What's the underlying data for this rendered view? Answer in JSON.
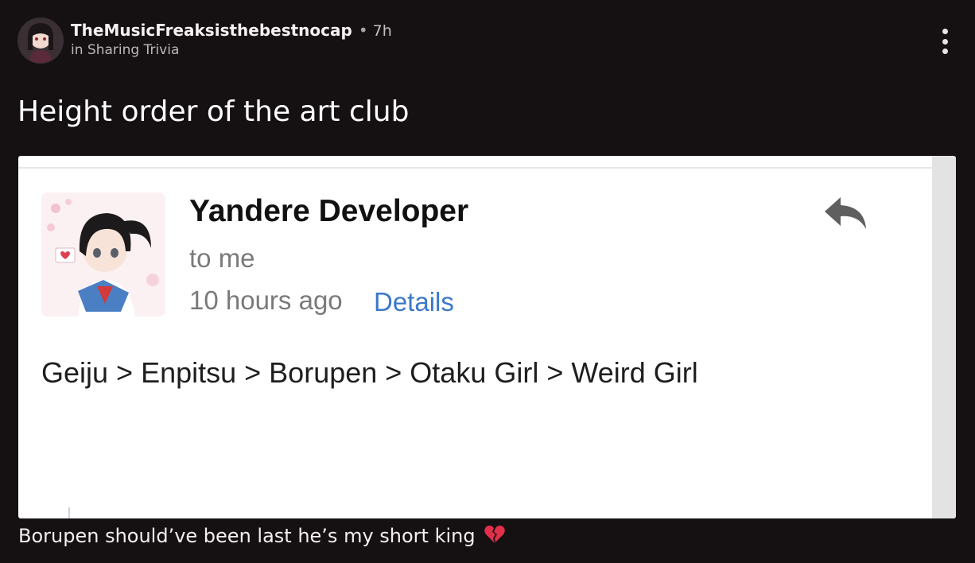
{
  "post": {
    "author": "TheMusicFreaksisthebestnocap",
    "separator": "•",
    "age": "7h",
    "community": "in Sharing Trivia",
    "title": "Height order of the art club",
    "caption": "Borupen should’ve been last he’s my short king"
  },
  "email": {
    "sender": "Yandere Developer",
    "recipient": "to me",
    "timestamp": "10 hours ago",
    "details_link": "Details",
    "body": "Geiju > Enpitsu > Borupen > Otaku Girl > Weird Girl"
  },
  "icons": {
    "menu": "more-vertical-icon",
    "reply": "reply-arrow-icon",
    "caption_emoji": "broken-heart-icon"
  },
  "colors": {
    "background": "#151012",
    "card": "#ffffff",
    "link": "#3b78c8",
    "emoji": "#e0304a"
  }
}
